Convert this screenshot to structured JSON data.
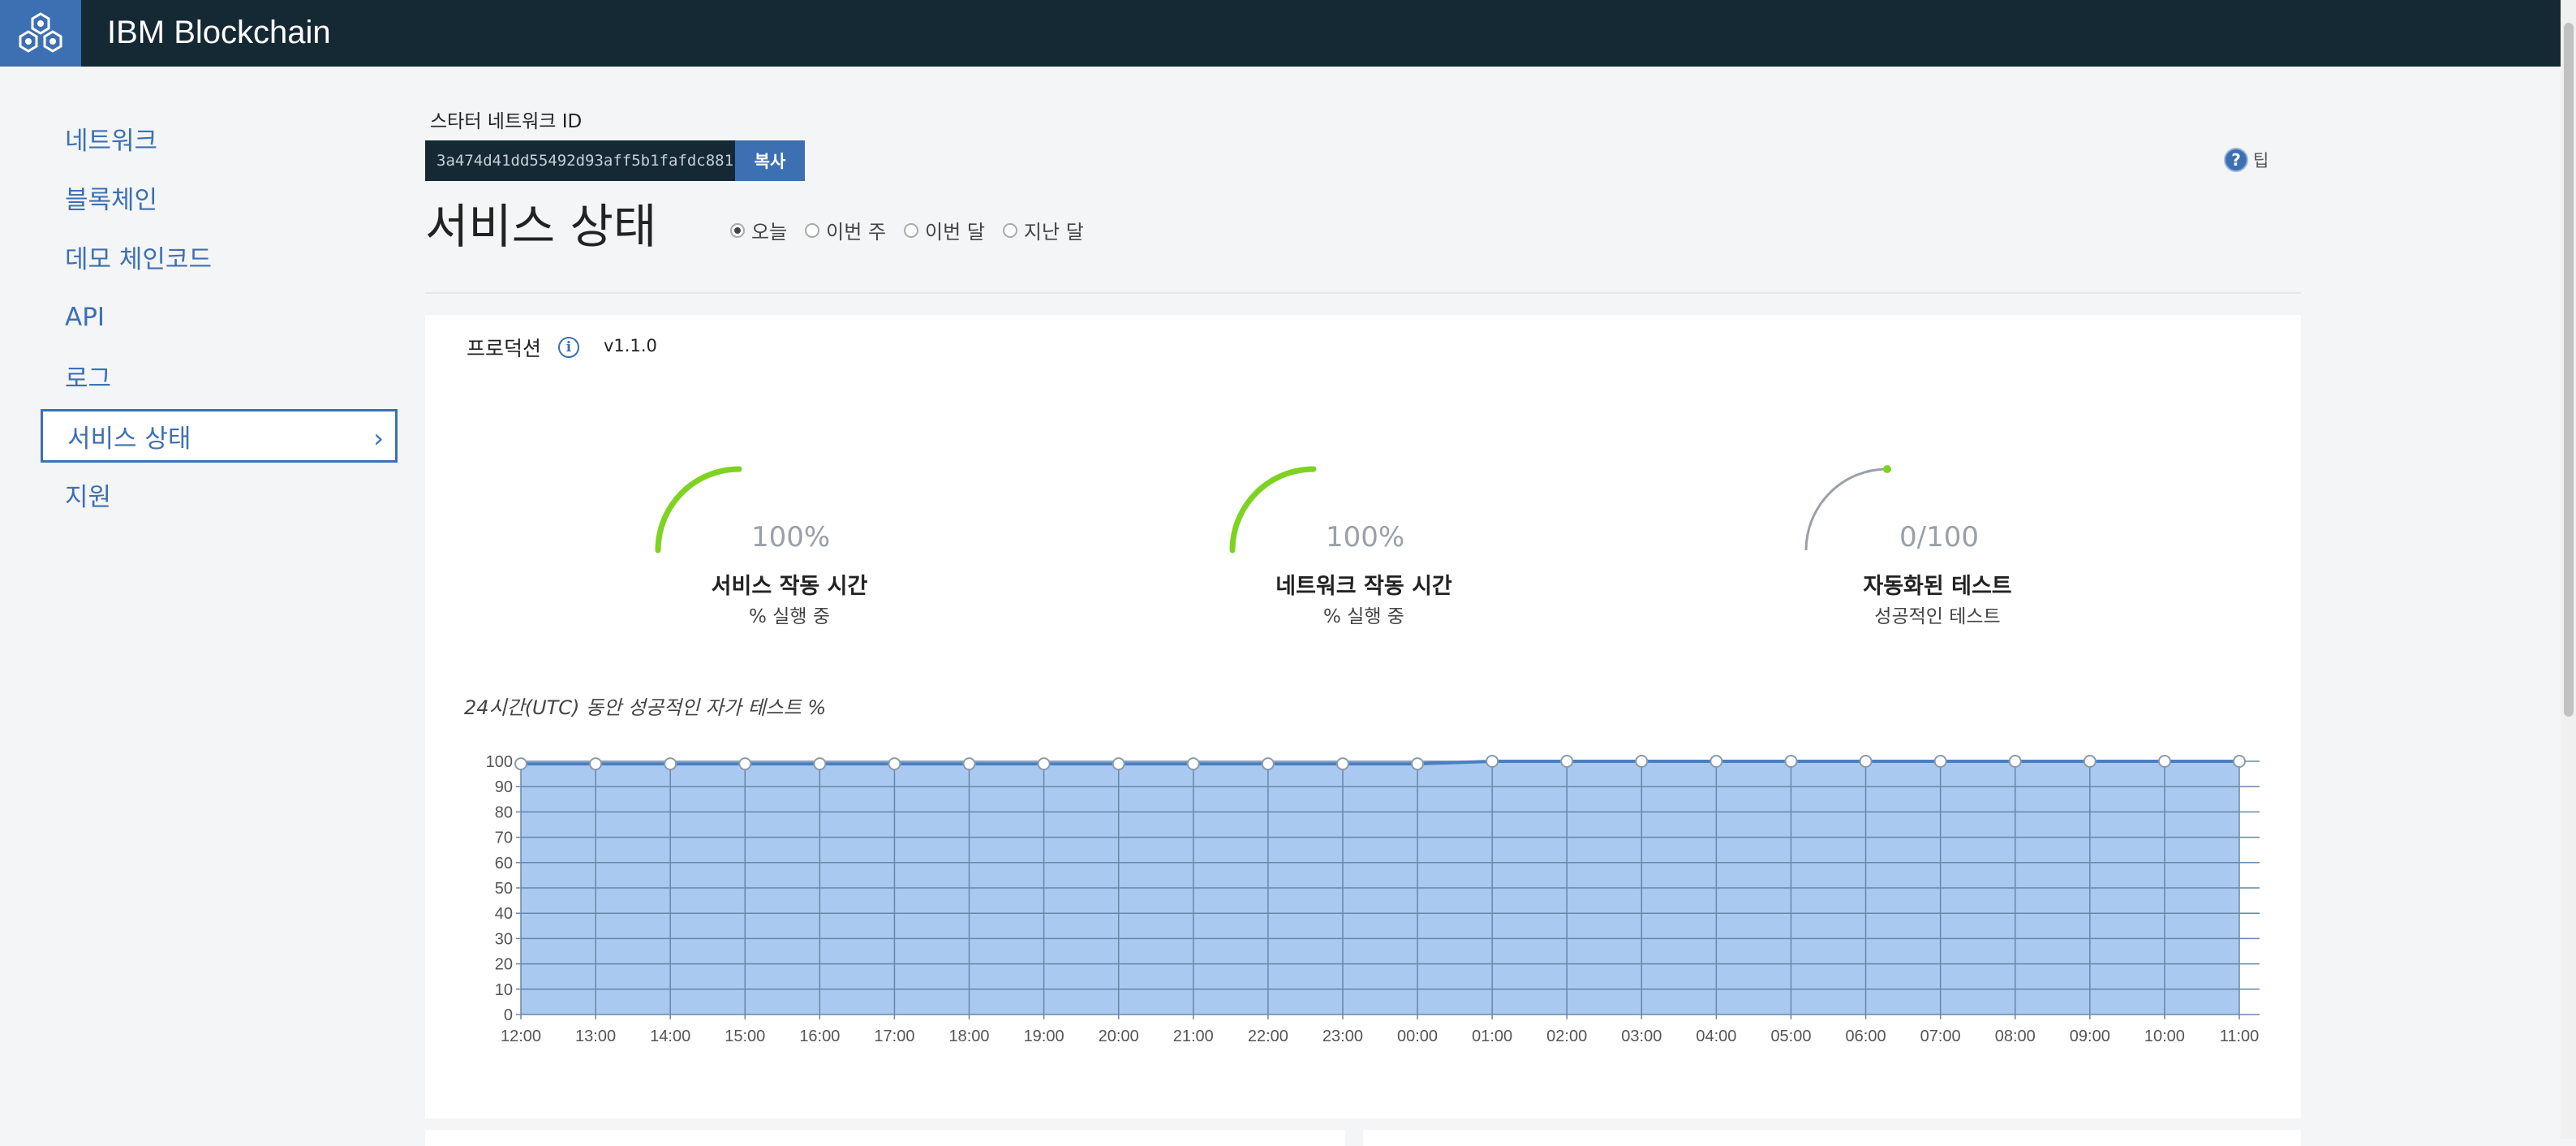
{
  "app": {
    "title": "IBM Blockchain",
    "logo_icon": "blockchain-cubes-icon"
  },
  "sidebar": {
    "items": [
      {
        "label": "네트워크",
        "active": false
      },
      {
        "label": "블록체인",
        "active": false
      },
      {
        "label": "데모 체인코드",
        "active": false
      },
      {
        "label": "API",
        "active": false
      },
      {
        "label": "로그",
        "active": false
      },
      {
        "label": "서비스 상태",
        "active": true
      },
      {
        "label": "지원",
        "active": false
      }
    ]
  },
  "network": {
    "id_label": "스타터 네트워크 ID",
    "id_value": "3a474d41dd55492d93aff5b1fafdc881",
    "copy_label": "복사"
  },
  "page": {
    "title": "서비스 상태"
  },
  "period": {
    "options": [
      "오늘",
      "이번 주",
      "이번 달",
      "지난 달"
    ],
    "selected": "오늘"
  },
  "tip": {
    "label": "팁"
  },
  "panel": {
    "env_label": "프로덕션",
    "version": "v1.1.0"
  },
  "gauges": [
    {
      "value_text": "100%",
      "fraction": 1.0,
      "title": "서비스 작동 시간",
      "subtitle": "% 실행 중",
      "color": "#7ed321"
    },
    {
      "value_text": "100%",
      "fraction": 1.0,
      "title": "네트워크 작동 시간",
      "subtitle": "% 실행 중",
      "color": "#7ed321"
    },
    {
      "value_text": "0/100",
      "fraction": 0.0,
      "title": "자동화된 테스트",
      "subtitle": "성공적인 테스트",
      "color": "#7ed321"
    }
  ],
  "chart_title": "24시간(UTC) 동안 성공적인 자가 테스트 %",
  "chart_data": {
    "type": "area",
    "x": [
      "12:00",
      "13:00",
      "14:00",
      "15:00",
      "16:00",
      "17:00",
      "18:00",
      "19:00",
      "20:00",
      "21:00",
      "22:00",
      "23:00",
      "00:00",
      "01:00",
      "02:00",
      "03:00",
      "04:00",
      "05:00",
      "06:00",
      "07:00",
      "08:00",
      "09:00",
      "10:00",
      "11:00"
    ],
    "series": [
      {
        "values": [
          99,
          99,
          99,
          99,
          99,
          99,
          99,
          99,
          99,
          99,
          99,
          99,
          99,
          100,
          100,
          100,
          100,
          100,
          100,
          100,
          100,
          100,
          100,
          100
        ]
      }
    ],
    "ylim": [
      0,
      100
    ],
    "yticks": [
      0,
      10,
      20,
      30,
      40,
      50,
      60,
      70,
      80,
      90,
      100
    ],
    "grid": true,
    "fill_color": "#a9c9f0",
    "line_color": "#4a7fc1"
  }
}
